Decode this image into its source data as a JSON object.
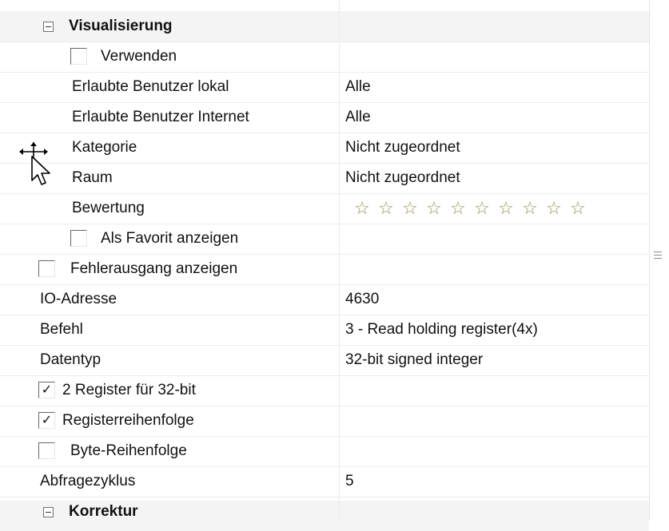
{
  "sections": {
    "visualisierung": "Visualisierung",
    "korrektur": "Korrektur"
  },
  "rows": {
    "verwenden": {
      "label": "Verwenden",
      "checked": false
    },
    "erlaubte_lokal": {
      "label": "Erlaubte Benutzer lokal",
      "value": "Alle"
    },
    "erlaubte_internet": {
      "label": "Erlaubte Benutzer Internet",
      "value": "Alle"
    },
    "kategorie": {
      "label": "Kategorie",
      "value": "Nicht zugeordnet"
    },
    "raum": {
      "label": "Raum",
      "value": "Nicht zugeordnet"
    },
    "bewertung": {
      "label": "Bewertung",
      "stars": 10,
      "rating": 0
    },
    "als_favorit": {
      "label": "Als Favorit anzeigen",
      "checked": false
    },
    "fehlerausgang": {
      "label": "Fehlerausgang anzeigen",
      "checked": false
    },
    "io_adresse": {
      "label": "IO-Adresse",
      "value": "4630"
    },
    "befehl": {
      "label": "Befehl",
      "value": "3 - Read holding register(4x)"
    },
    "datentyp": {
      "label": "Datentyp",
      "value": "32-bit signed integer"
    },
    "zwei_register": {
      "label": "2 Register für 32-bit",
      "checked": true
    },
    "registerreihenfolge": {
      "label": "Registerreihenfolge",
      "checked": true
    },
    "byte_reihenfolge": {
      "label": "Byte-Reihenfolge",
      "checked": false
    },
    "abfragezyklus": {
      "label": "Abfragezyklus",
      "value": "5"
    }
  },
  "glyphs": {
    "check": "✓",
    "star": "☆"
  },
  "colors": {
    "grid_line": "#ececec",
    "star": "#9b8b55"
  }
}
